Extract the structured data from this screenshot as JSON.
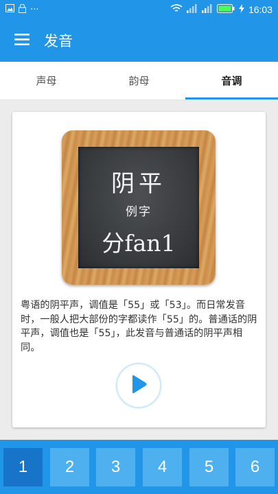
{
  "status_bar": {
    "dots": "···",
    "time": "16:03",
    "icons": [
      "image-icon",
      "lock-icon",
      "more-icon",
      "wifi-icon",
      "signal-icon",
      "signal-icon",
      "battery-icon",
      "charging-icon"
    ]
  },
  "app_bar": {
    "menu_icon": "menu-icon",
    "title": "发音"
  },
  "tabs": [
    {
      "label": "声母",
      "active": false
    },
    {
      "label": "韵母",
      "active": false
    },
    {
      "label": "音调",
      "active": true
    }
  ],
  "card": {
    "board": {
      "line1": "阴平",
      "line2": "例字",
      "line3": "分fan1"
    },
    "description": "粤语的阴平声，调值是「55」或「53」。而日常发音时，一般人把大部份的字都读作「55」的。普通话的阴平声，调值也是「55」，此发音与普通话的阴平声相同。",
    "play_icon": "play-icon"
  },
  "bottom_nav": {
    "buttons": [
      "1",
      "2",
      "3",
      "4",
      "5",
      "6"
    ],
    "active_index": 0
  },
  "colors": {
    "primary": "#2196e9",
    "button": "#4fb0f0",
    "button_active": "#1774c9",
    "play": "#2196e9"
  }
}
